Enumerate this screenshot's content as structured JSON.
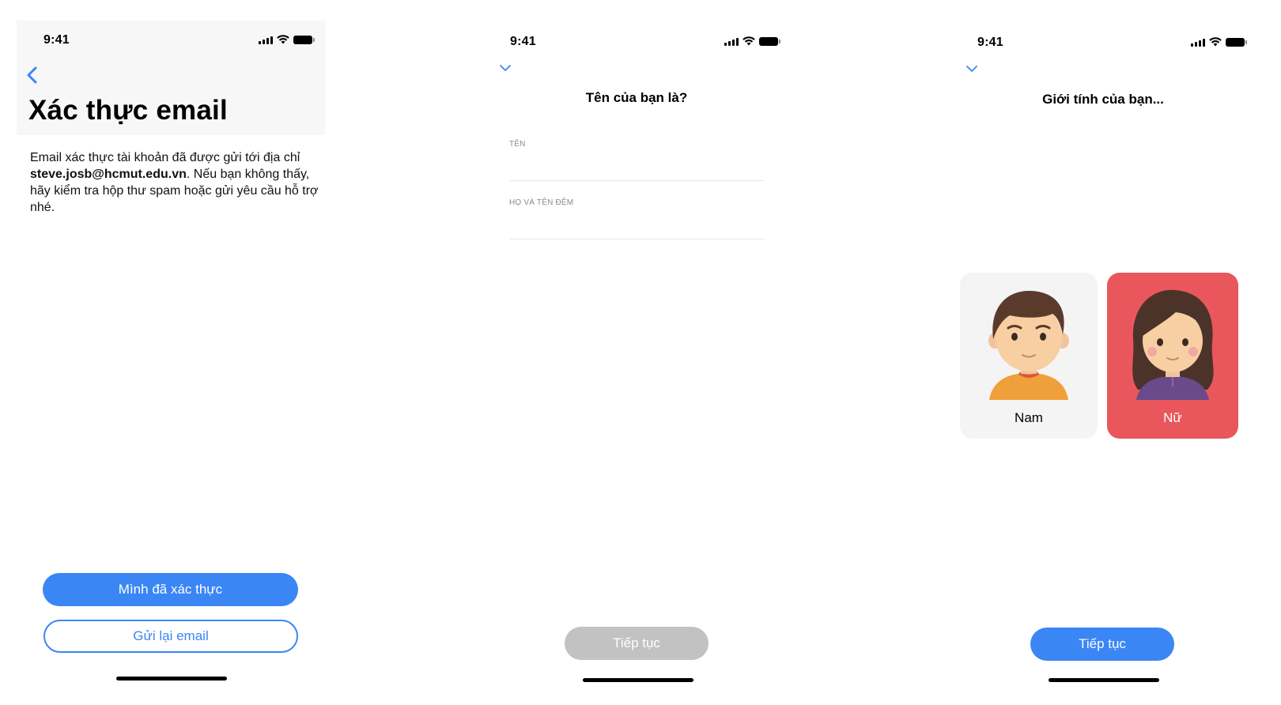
{
  "screen1": {
    "time": "9:41",
    "title": "Xác thực email",
    "desc_before": "Email xác thực tài khoản đã được gửi tới địa chỉ ",
    "desc_email": "steve.josb@hcmut.edu.vn",
    "desc_after": ". Nếu bạn không thấy, hãy kiểm tra hộp thư spam hoặc gửi yêu cầu hỗ trợ nhé.",
    "primary_button": "Mình đã xác thực",
    "secondary_button": "Gửi lại email"
  },
  "screen2": {
    "time": "9:41",
    "heading": "Tên của bạn là?",
    "field_first_label": "TÊN",
    "field_last_label": "HỌ VÀ TÊN ĐỆM",
    "continue_button": "Tiếp tục"
  },
  "screen3": {
    "time": "9:41",
    "heading": "Giới tính của bạn...",
    "option_male": "Nam",
    "option_female": "Nữ",
    "selected": "Nữ",
    "continue_button": "Tiếp tục"
  },
  "colors": {
    "accent": "#3a86f5",
    "selected_card": "#e9575c",
    "disabled_button": "#c2c2c2"
  }
}
